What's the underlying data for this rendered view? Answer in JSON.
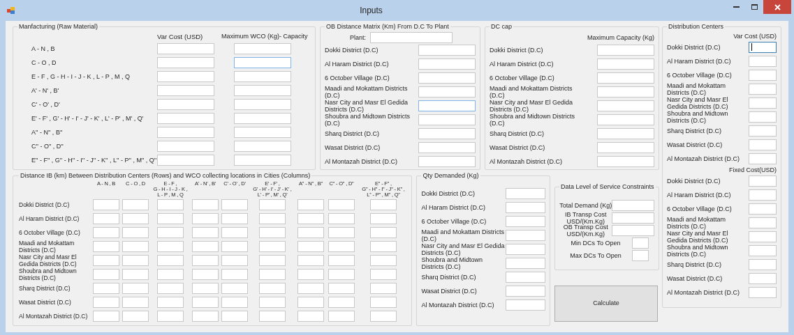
{
  "window": {
    "title": "Inputs"
  },
  "manufacturing": {
    "title": "Manfacturing (Raw Material)",
    "columns": [
      "Var Cost (USD)",
      "Maximum WCO (Kg)- Capacity"
    ],
    "rows": [
      {
        "label": "A - N , B",
        "var_cost_highlighted": false,
        "capacity_highlighted": false
      },
      {
        "label": "C - O , D",
        "var_cost_highlighted": false,
        "capacity_highlighted": true
      },
      {
        "label": "E - F , G - H - I - J - K , L - P , M , Q",
        "var_cost_highlighted": false,
        "capacity_highlighted": false
      },
      {
        "label": "A' - N' , B'",
        "var_cost_highlighted": false,
        "capacity_highlighted": false
      },
      {
        "label": "C' - O' , D'",
        "var_cost_highlighted": false,
        "capacity_highlighted": false
      },
      {
        "label": "E' - F' , G' - H' - I' - J' - K' , L' - P' , M' , Q'",
        "var_cost_highlighted": false,
        "capacity_highlighted": false
      },
      {
        "label": "A'' - N'' , B''",
        "var_cost_highlighted": false,
        "capacity_highlighted": false
      },
      {
        "label": "C'' - O'' , D''",
        "var_cost_highlighted": false,
        "capacity_highlighted": false
      },
      {
        "label": "E'' - F'' , G'' - H'' - I'' - J'' - K'' , L'' - P'' , M'' , Q''",
        "var_cost_highlighted": false,
        "capacity_highlighted": false
      }
    ]
  },
  "ob_distance": {
    "title": "OB Distance Matrix  (Km) From D.C To Plant",
    "plant_label": "Plant:",
    "rows": [
      {
        "label": "Dokki District (D.C)",
        "highlighted": false
      },
      {
        "label": "Al Haram District (D.C)",
        "highlighted": false
      },
      {
        "label": "6 October Village (D.C)",
        "highlighted": false
      },
      {
        "label": "Maadi and Mokattam Districts (D.C)",
        "highlighted": false
      },
      {
        "label": "Nasr City and Masr El Gedida Districts (D.C)",
        "highlighted": true
      },
      {
        "label": "Shoubra and Midtown Districts (D.C)",
        "highlighted": false
      },
      {
        "label": "Sharq District (D.C)",
        "highlighted": false
      },
      {
        "label": "Wasat District (D.C)",
        "highlighted": false
      },
      {
        "label": "Al Montazah District (D.C)",
        "highlighted": false
      }
    ]
  },
  "dc_cap": {
    "title": "DC cap",
    "column": "Maximum Capacity (Kg)",
    "rows": [
      {
        "label": "Dokki District (D.C)"
      },
      {
        "label": "Al Haram District (D.C)"
      },
      {
        "label": "6 October Village (D.C)"
      },
      {
        "label": "Maadi and Mokattam Districts (D.C)"
      },
      {
        "label": "Nasr City and Masr El Gedida Districts (D.C)"
      },
      {
        "label": "Shoubra and Midtown Districts (D.C)"
      },
      {
        "label": "Sharq District (D.C)"
      },
      {
        "label": "Wasat District (D.C)"
      },
      {
        "label": "Al Montazah District (D.C)"
      }
    ]
  },
  "distribution_centers": {
    "title": "Distribution Centers",
    "sections": [
      {
        "column": "Var Cost (USD)",
        "rows": [
          {
            "label": "Dokki District (D.C)",
            "focused": true
          },
          {
            "label": "Al Haram District (D.C)",
            "focused": false
          },
          {
            "label": "6 October Village (D.C)",
            "focused": false
          },
          {
            "label": "Maadi and Mokattam Districts (D.C)",
            "focused": false
          },
          {
            "label": "Nasr City and Masr El Gedida Districts (D.C)",
            "focused": false
          },
          {
            "label": "Shoubra and Midtown Districts (D.C)",
            "focused": false
          },
          {
            "label": "Sharq District (D.C)",
            "focused": false
          },
          {
            "label": "Wasat District (D.C)",
            "focused": false
          },
          {
            "label": "Al Montazah District (D.C)",
            "focused": false
          }
        ]
      },
      {
        "column": "Fixed Cost(USD)",
        "rows": [
          {
            "label": "Dokki District (D.C)",
            "focused": false
          },
          {
            "label": "Al Haram District (D.C)",
            "focused": false
          },
          {
            "label": "6 October Village (D.C)",
            "focused": false
          },
          {
            "label": "Maadi and Mokattam Districts (D.C)",
            "focused": false
          },
          {
            "label": "Nasr City and Masr El Gedida Districts (D.C)",
            "focused": false
          },
          {
            "label": "Shoubra and Midtown Districts (D.C)",
            "focused": false
          },
          {
            "label": "Sharq District (D.C)",
            "focused": false
          },
          {
            "label": "Wasat District (D.C)",
            "focused": false
          },
          {
            "label": "Al Montazah District (D.C)",
            "focused": false
          }
        ]
      }
    ]
  },
  "ib_distance": {
    "title": "Distance IB (km) Between  Distribution Centers (Rows) and WCO collecting locations in Cities (Columns)",
    "columns": [
      "A - N , B",
      "C - O , D",
      "E - F ,\nG - H - I - J - K ,\nL - P , M , Q",
      "A' - N' , B'",
      "C' - O' , D'",
      "E' - F' ,\nG' - H' - I' - J' - K' ,\nL' - P' , M' , Q'",
      "A'' - N'' , B''",
      "C'' - O'' , D''",
      "E'' - F'' ,\nG'' - H'' - I'' - J'' - K'' ,\nL'' - P'' , M'' , Q''"
    ],
    "rows": [
      {
        "label": "Dokki District (D.C)"
      },
      {
        "label": "Al Haram District (D.C)"
      },
      {
        "label": "6 October Village (D.C)"
      },
      {
        "label": "Maadi and Mokattam Districts (D.C)"
      },
      {
        "label": "Nasr City and Masr El Gedida Districts (D.C)"
      },
      {
        "label": "Shoubra and Midtown Districts (D.C)"
      },
      {
        "label": "Sharq District (D.C)"
      },
      {
        "label": "Wasat District (D.C)"
      },
      {
        "label": "Al Montazah District (D.C)"
      }
    ]
  },
  "qty_demanded": {
    "title": "Qty Demanded (Kg)",
    "rows": [
      {
        "label": "Dokki District (D.C)"
      },
      {
        "label": "Al Haram District (D.C)"
      },
      {
        "label": "6 October Village (D.C)"
      },
      {
        "label": "Maadi and Mokattam Districts (D.C)"
      },
      {
        "label": "Nasr City and Masr El Gedida Districts (D.C)"
      },
      {
        "label": "Shoubra and Midtown Districts (D.C)"
      },
      {
        "label": "Sharq District (D.C)"
      },
      {
        "label": "Wasat District (D.C)"
      },
      {
        "label": "Al Montazah District (D.C)"
      }
    ]
  },
  "service_constraints": {
    "title": "Data  Level of Service Constraints",
    "fields": [
      {
        "label": "Total Demand (Kg)",
        "kind": "wide"
      },
      {
        "label": "IB Transp Cost\nUSD/(Km.Kg)",
        "kind": "wide"
      },
      {
        "label": "OB Transp Cost\nUSD/(Km.Kg)",
        "kind": "wide"
      },
      {
        "label": "Min DCs To Open",
        "kind": "small"
      },
      {
        "label": "Max DCs To Open",
        "kind": "small"
      }
    ]
  },
  "calculate_button": "Calculate"
}
